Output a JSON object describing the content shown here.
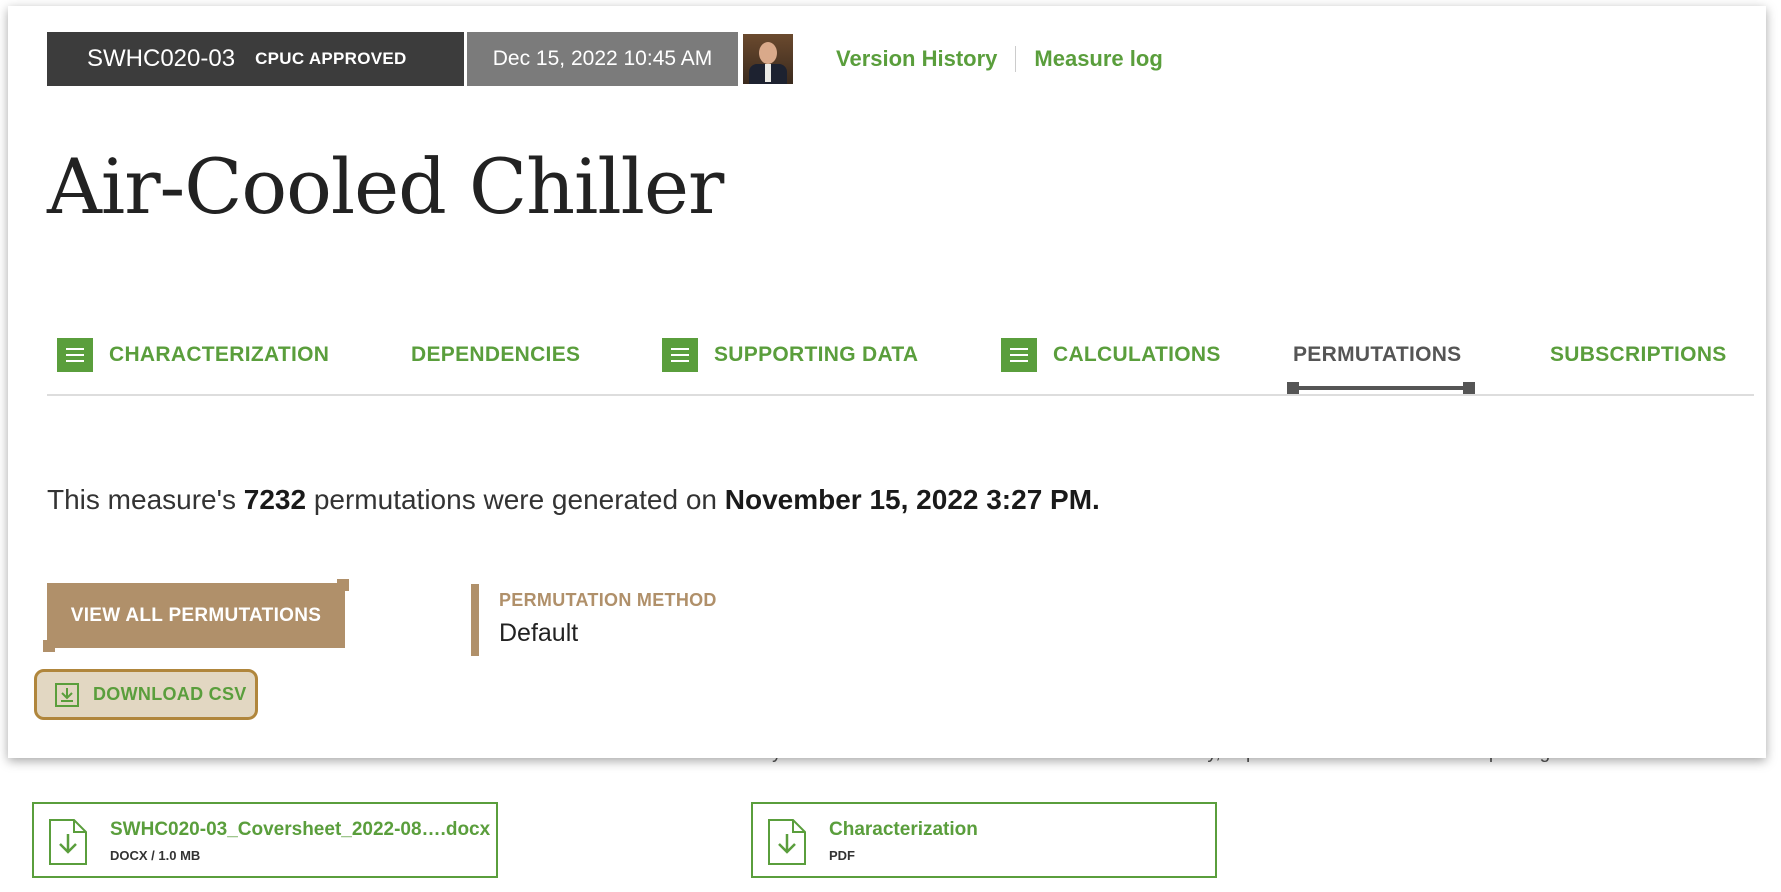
{
  "background": {
    "partial_text": "or you can download a PDF of the characterization only, separate from the full measure package.",
    "files": [
      {
        "name": "SWHC020-03_Coversheet_2022-08….docx",
        "meta": "DOCX  /  1.0 MB",
        "icon": "file-download-icon"
      },
      {
        "name": "Characterization",
        "meta": "PDF",
        "icon": "file-download-icon"
      }
    ]
  },
  "header": {
    "measure_id": "SWHC020-03",
    "status": "CPUC APPROVED",
    "datetime": "Dec 15, 2022 10:45 AM",
    "avatar_icon": "user-avatar",
    "links": {
      "version_history": "Version History",
      "measure_log": "Measure log"
    }
  },
  "title": "Air-Cooled Chiller",
  "tabs": [
    {
      "label": "CHARACTERIZATION",
      "icon": "list-icon",
      "active": false
    },
    {
      "label": "DEPENDENCIES",
      "icon": null,
      "active": false
    },
    {
      "label": "SUPPORTING DATA",
      "icon": "list-icon",
      "active": false
    },
    {
      "label": "CALCULATIONS",
      "icon": "list-icon",
      "active": false
    },
    {
      "label": "PERMUTATIONS",
      "icon": null,
      "active": true
    },
    {
      "label": "SUBSCRIPTIONS",
      "icon": null,
      "active": false
    }
  ],
  "permutations": {
    "text_before": "This measure's ",
    "count": "7232",
    "text_middle": " permutations were generated on ",
    "generated_on": "November 15, 2022 3:27 PM.",
    "view_all_label": "VIEW ALL PERMUTATIONS",
    "method_label": "PERMUTATION METHOD",
    "method_value": "Default",
    "download_label": "DOWNLOAD CSV"
  },
  "colors": {
    "green": "#5a9e3c",
    "tan": "#b0906a",
    "dark": "#3c3c3c",
    "grey": "#7b7b7b"
  }
}
